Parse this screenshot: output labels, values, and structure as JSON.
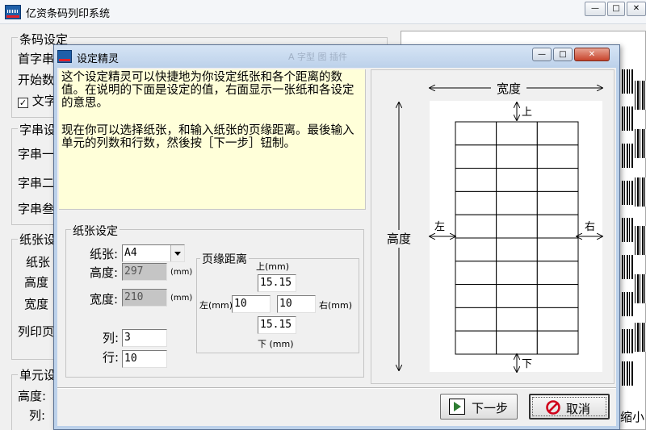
{
  "main_window": {
    "title": "亿资条码列印系统",
    "side_labels": [
      "条码设定",
      "首字串",
      "开始数",
      "文字",
      "字串设",
      "字串一",
      "字串二",
      "字串叁",
      "纸张设",
      "纸张",
      "高度",
      "宽度",
      "列印页",
      "单元设",
      "高度:",
      "列:"
    ],
    "preview_fragment": "缩小"
  },
  "dialog": {
    "title": "设定精灵",
    "ghost_toolbar": "A 字型   图 插件",
    "description": [
      "这个设定精灵可以快捷地为你设定纸张和各个距离的数值。在说明的下面是设定的值，右面显示一张纸和各设定的意思。",
      "现在你可以选择纸张，和输入纸张的页缘距离。最後输入单元的列数和行数，然後按［下一步］钮制。"
    ]
  },
  "paper_settings": {
    "group_title": "纸张设定",
    "paper_label": "纸张:",
    "paper_value": "A4",
    "height_label": "高度:",
    "height_value": "297",
    "width_label": "宽度:",
    "width_value": "210",
    "unit_mm": "(mm)",
    "columns_label": "列:",
    "columns_value": "3",
    "rows_label": "行:",
    "rows_value": "10"
  },
  "margins": {
    "group_title": "页缘距离",
    "top_label": "上(mm)",
    "top_value": "15.15",
    "left_label": "左(mm)",
    "left_value": "10",
    "right_value": "10",
    "right_label": "右(mm)",
    "bottom_value": "15.15",
    "bottom_label": "下 (mm)"
  },
  "diagram": {
    "width_label": "宽度",
    "height_label": "高度",
    "top_label": "上",
    "bottom_label": "下",
    "left_label": "左",
    "right_label": "右",
    "grid_columns": 3,
    "grid_rows": 10
  },
  "buttons": {
    "next": "下一步",
    "cancel": "取消"
  },
  "colors": {
    "description_bg": "#ffffd9",
    "dialog_frame": "#bcd1ea",
    "close_button": "#c7432b",
    "cancel_icon": "#d0021b",
    "next_icon": "#2e7d32"
  }
}
